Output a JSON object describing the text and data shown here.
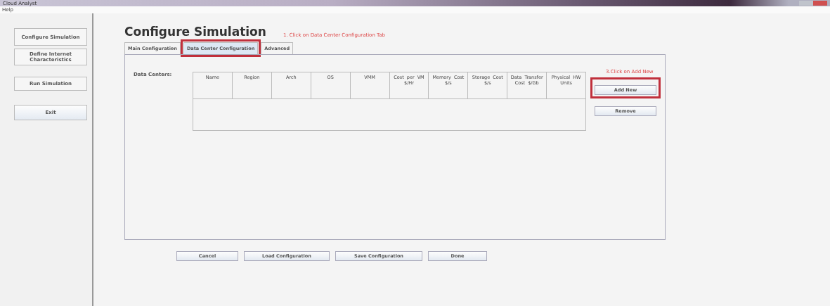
{
  "window": {
    "title": "Cloud Analyst"
  },
  "menu": [
    "Help"
  ],
  "sidebar": [
    {
      "label": "Configure Simulation"
    },
    {
      "label": "Define Internet Characteristics"
    },
    {
      "label": "Run Simulation"
    },
    {
      "label": "Exit"
    }
  ],
  "heading": "Configure Simulation",
  "annotations": [
    "1. Click on Data Center Configuration Tab",
    "3.Click on Add New"
  ],
  "tabs": [
    {
      "label": "Main Configuration",
      "selected": false,
      "highlighted": false
    },
    {
      "label": "Data Center Configuration",
      "selected": true,
      "highlighted": true
    },
    {
      "label": "Advanced",
      "selected": false,
      "highlighted": false
    }
  ],
  "table": {
    "label": "Data Centers:",
    "columns": [
      "Name",
      "Region",
      "Arch",
      "OS",
      "VMM",
      "Cost per VM $/Hr",
      "Memory Cost $/s",
      "Storage Cost $/s",
      "Data Transfer Cost $/Gb",
      "Physical HW Units"
    ]
  },
  "side_buttons": [
    {
      "label": "Add New",
      "highlighted": true
    },
    {
      "label": "Remove",
      "highlighted": false
    }
  ],
  "footer_buttons": [
    "Cancel",
    "Load Configuration",
    "Save Configuration",
    "Done"
  ]
}
